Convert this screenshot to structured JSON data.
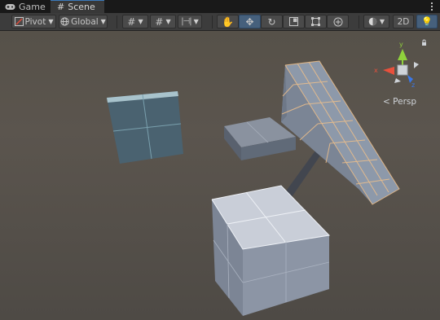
{
  "tabs": [
    {
      "label": "Game",
      "icon": "gamepad-icon"
    },
    {
      "label": "Scene",
      "icon": "grid-icon"
    }
  ],
  "toolbar": {
    "pivot_label": "Pivot",
    "global_label": "Global",
    "mode_2d_label": "2D",
    "active_tool": "move-tool"
  },
  "gizmo": {
    "projection_label": "Persp",
    "axes": {
      "x": "x",
      "y": "y",
      "z": "z"
    },
    "colors": {
      "x": "#e8503c",
      "y": "#8fd13c",
      "z": "#3a78e8"
    }
  },
  "scene": {
    "background": "#59534c",
    "object_color": "#8a96a6",
    "selection_outline": "#f0c08a"
  }
}
